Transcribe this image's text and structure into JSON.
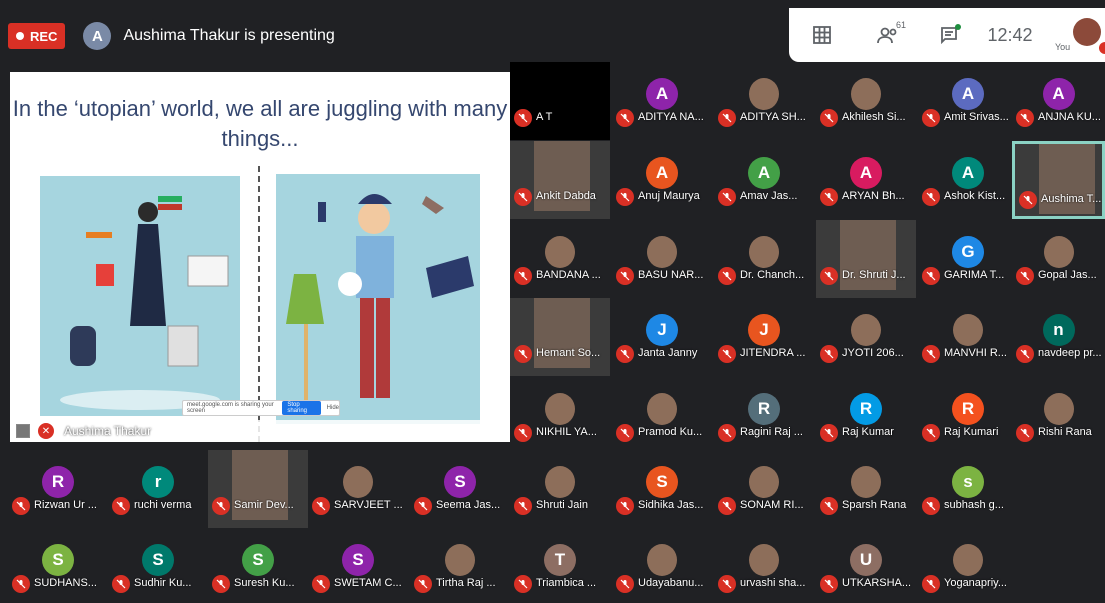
{
  "recording": {
    "label": "REC"
  },
  "presenter": {
    "initial": "A",
    "text": "Aushima Thakur is presenting",
    "tile_name": "Aushima Thakur"
  },
  "controls": {
    "people_count": "61",
    "time": "12:42",
    "you_label": "You"
  },
  "slide": {
    "title": "In the ‘utopian’ world, we all are juggling with many things...",
    "share_notice": "meet.google.com is sharing your screen",
    "stop_sharing": "Stop sharing",
    "hide": "Hide"
  },
  "participants": [
    {
      "name": "A T",
      "initial": "",
      "color": "",
      "type": "black"
    },
    {
      "name": "ADITYA NA...",
      "initial": "A",
      "color": "#8e24aa",
      "type": "avatar"
    },
    {
      "name": "ADITYA SH...",
      "initial": "",
      "color": "",
      "type": "photo"
    },
    {
      "name": "Akhilesh Si...",
      "initial": "",
      "color": "",
      "type": "photo"
    },
    {
      "name": "Amit Srivas...",
      "initial": "A",
      "color": "#5c6bc0",
      "type": "avatar"
    },
    {
      "name": "ANJNA KU...",
      "initial": "A",
      "color": "#8e24aa",
      "type": "avatar"
    },
    {
      "name": "Ankit Dabda",
      "initial": "",
      "color": "",
      "type": "video"
    },
    {
      "name": "Anuj Maurya",
      "initial": "A",
      "color": "#e8551f",
      "type": "avatar"
    },
    {
      "name": "Amav Jas...",
      "initial": "A",
      "color": "#43a047",
      "type": "avatar"
    },
    {
      "name": "ARYAN Bh...",
      "initial": "A",
      "color": "#d81b60",
      "type": "avatar"
    },
    {
      "name": "Ashok Kist...",
      "initial": "A",
      "color": "#00897b",
      "type": "avatar"
    },
    {
      "name": "Aushima T...",
      "initial": "",
      "color": "",
      "type": "active"
    },
    {
      "name": "BANDANA ...",
      "initial": "",
      "color": "",
      "type": "photo"
    },
    {
      "name": "BASU NAR...",
      "initial": "",
      "color": "",
      "type": "photo"
    },
    {
      "name": "Dr. Chanch...",
      "initial": "",
      "color": "",
      "type": "photo"
    },
    {
      "name": "Dr. Shruti J...",
      "initial": "",
      "color": "",
      "type": "video"
    },
    {
      "name": "GARIMA T...",
      "initial": "G",
      "color": "#1e88e5",
      "type": "avatar"
    },
    {
      "name": "Gopal Jas...",
      "initial": "",
      "color": "",
      "type": "photo"
    },
    {
      "name": "Hemant So...",
      "initial": "",
      "color": "",
      "type": "video"
    },
    {
      "name": "Janta Janny",
      "initial": "J",
      "color": "#1e88e5",
      "type": "avatar"
    },
    {
      "name": "JITENDRA ...",
      "initial": "J",
      "color": "#e8551f",
      "type": "avatar"
    },
    {
      "name": "JYOTI 206...",
      "initial": "",
      "color": "",
      "type": "photo"
    },
    {
      "name": "MANVHI R...",
      "initial": "",
      "color": "",
      "type": "photo"
    },
    {
      "name": "navdeep pr...",
      "initial": "n",
      "color": "#00695c",
      "type": "avatar"
    },
    {
      "name": "NIKHIL YA...",
      "initial": "",
      "color": "",
      "type": "photo"
    },
    {
      "name": "Pramod Ku...",
      "initial": "",
      "color": "",
      "type": "photo"
    },
    {
      "name": "Ragini Raj ...",
      "initial": "R",
      "color": "#546e7a",
      "type": "avatar"
    },
    {
      "name": "Raj Kumar",
      "initial": "R",
      "color": "#039be5",
      "type": "avatar"
    },
    {
      "name": "Raj Kumari",
      "initial": "R",
      "color": "#f4511e",
      "type": "avatar"
    },
    {
      "name": "Rishi Rana",
      "initial": "",
      "color": "",
      "type": "photo"
    },
    {
      "name": "Rizwan Ur ...",
      "initial": "R",
      "color": "#8e24aa",
      "type": "avatar"
    },
    {
      "name": "ruchi verma",
      "initial": "r",
      "color": "#00897b",
      "type": "avatar"
    },
    {
      "name": "Samir Dev...",
      "initial": "",
      "color": "",
      "type": "video"
    },
    {
      "name": "SARVJEET ...",
      "initial": "",
      "color": "",
      "type": "photo"
    },
    {
      "name": "Seema Jas...",
      "initial": "S",
      "color": "#8e24aa",
      "type": "avatar"
    },
    {
      "name": "Shruti Jain",
      "initial": "",
      "color": "",
      "type": "photo"
    },
    {
      "name": "Sidhika Jas...",
      "initial": "S",
      "color": "#e8551f",
      "type": "avatar"
    },
    {
      "name": "SONAM RI...",
      "initial": "",
      "color": "",
      "type": "photo"
    },
    {
      "name": "Sparsh Rana",
      "initial": "",
      "color": "",
      "type": "photo"
    },
    {
      "name": "subhash g...",
      "initial": "s",
      "color": "#7cb342",
      "type": "avatar"
    },
    {
      "name": "SUDHANS...",
      "initial": "S",
      "color": "#7cb342",
      "type": "avatar"
    },
    {
      "name": "Sudhir Ku...",
      "initial": "S",
      "color": "#00796b",
      "type": "avatar"
    },
    {
      "name": "Suresh Ku...",
      "initial": "S",
      "color": "#43a047",
      "type": "avatar"
    },
    {
      "name": "SWETAM C...",
      "initial": "S",
      "color": "#8e24aa",
      "type": "avatar"
    },
    {
      "name": "Tirtha Raj ...",
      "initial": "",
      "color": "",
      "type": "photo"
    },
    {
      "name": "Triambica ...",
      "initial": "T",
      "color": "#8d6e63",
      "type": "avatar"
    },
    {
      "name": "Udayabanu...",
      "initial": "",
      "color": "",
      "type": "photo"
    },
    {
      "name": "urvashi sha...",
      "initial": "",
      "color": "",
      "type": "photo"
    },
    {
      "name": "UTKARSHA...",
      "initial": "U",
      "color": "#8d6e63",
      "type": "avatar"
    },
    {
      "name": "Yoganapriy...",
      "initial": "",
      "color": "",
      "type": "photo"
    }
  ]
}
